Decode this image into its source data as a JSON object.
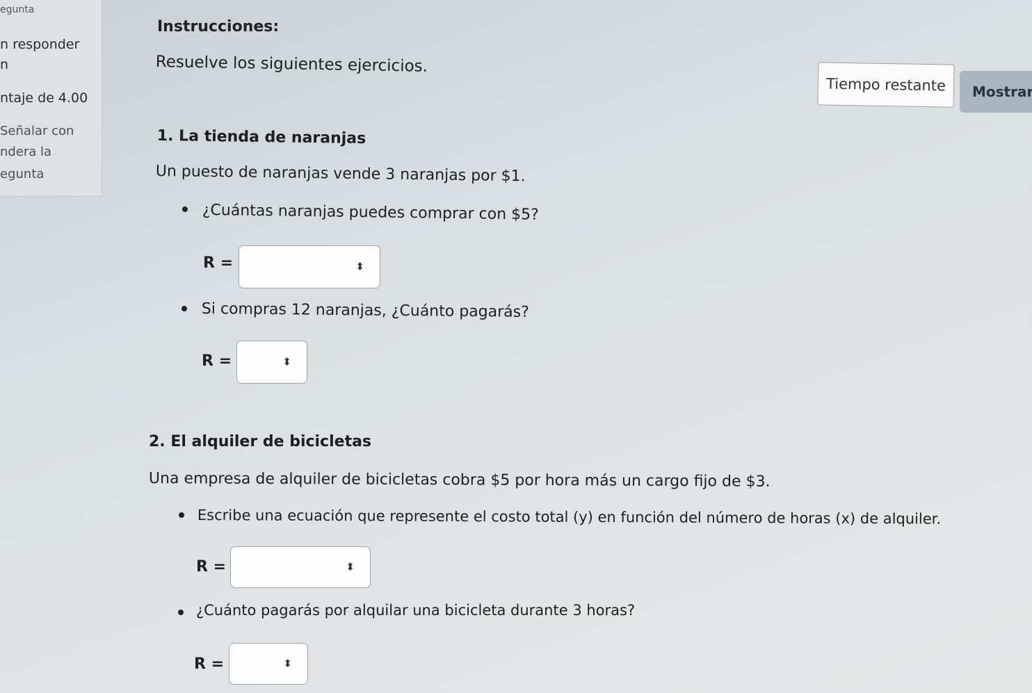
{
  "sidebar": {
    "items": [
      "egunta",
      "n responder",
      "n",
      "ntaje de 4.00",
      "Señalar con",
      "ndera la",
      "egunta"
    ]
  },
  "header": {
    "instructions_label": "Instrucciones:",
    "instructions_text": "Resuelve los siguientes ejercicios.",
    "timer_label": "Tiempo restante",
    "show_label": "Mostrar"
  },
  "questions": [
    {
      "title": "1. La tienda de naranjas",
      "statement": "Un puesto de naranjas vende 3 naranjas por $1.",
      "parts": [
        {
          "prompt": "¿Cuántas naranjas puedes comprar con $5?",
          "answer_label": "R =",
          "value": ""
        },
        {
          "prompt": "Si compras 12 naranjas, ¿Cuánto pagarás?",
          "answer_label": "R =",
          "value": ""
        }
      ]
    },
    {
      "title": "2. El alquiler de bicicletas",
      "statement": "Una empresa de alquiler de bicicletas cobra $5 por hora más un cargo fijo de $3.",
      "parts": [
        {
          "prompt": "Escribe una ecuación que represente el costo total (y) en función del número de horas (x) de alquiler.",
          "answer_label": "R =",
          "value": ""
        },
        {
          "prompt": "¿Cuánto pagarás por alquilar una bicicleta durante 3 horas?",
          "answer_label": "R =",
          "value": ""
        }
      ]
    }
  ],
  "icons": {
    "select_arrow": "updown-arrow-icon"
  },
  "colors": {
    "show_button": "#a9b6c2",
    "timer_border": "#9aa1a6"
  }
}
